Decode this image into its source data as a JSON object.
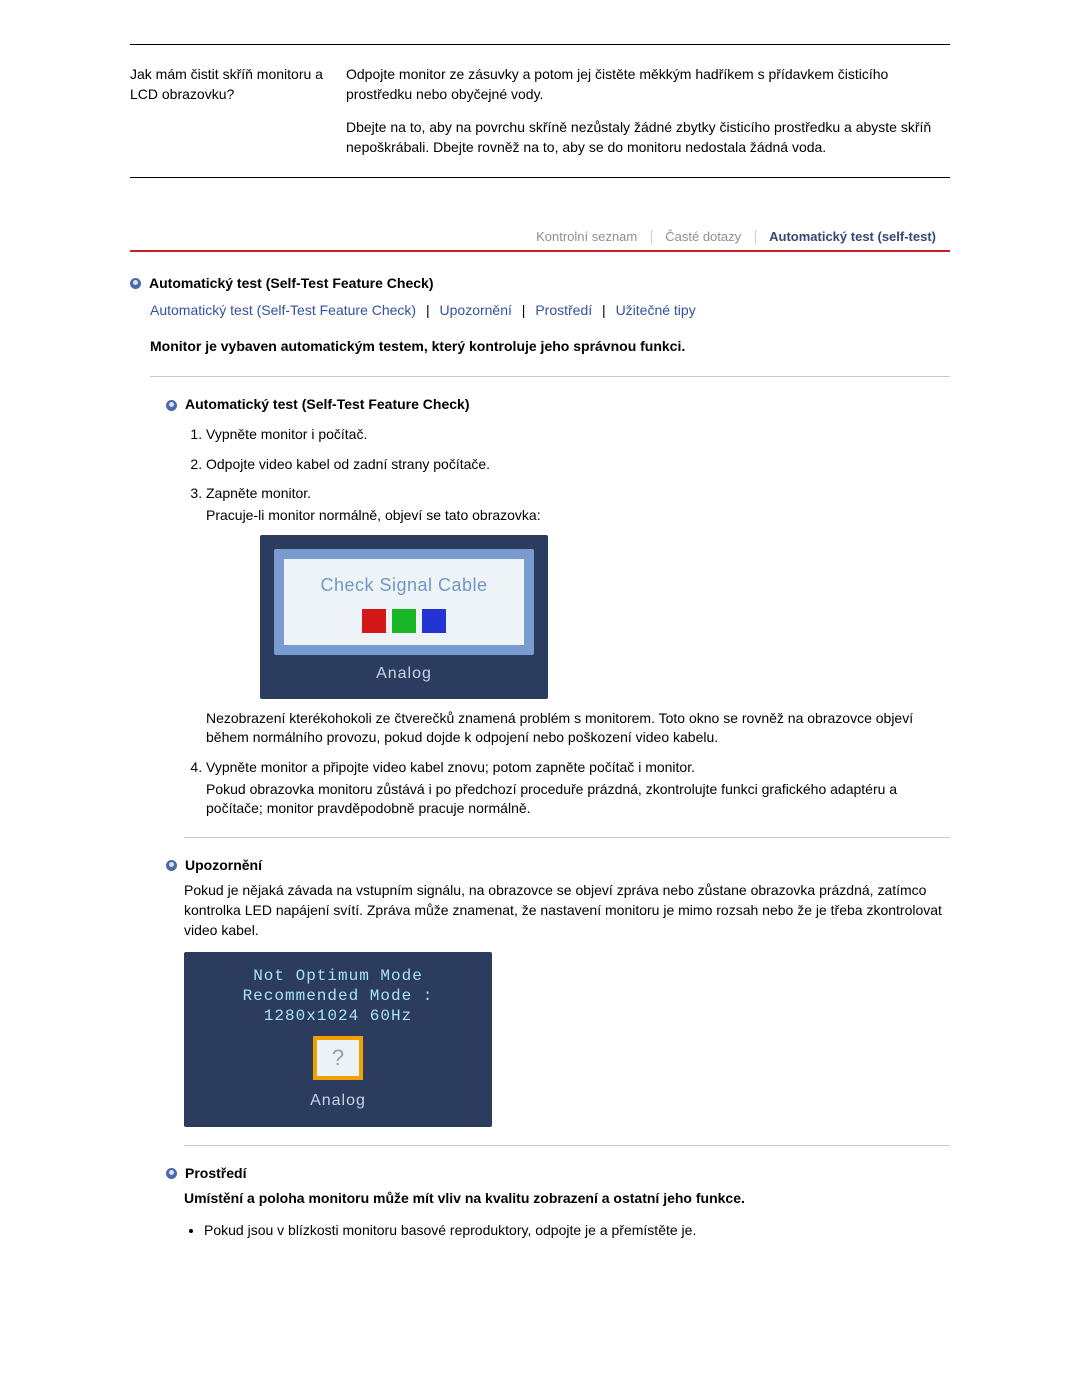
{
  "faq": {
    "question": "Jak mám čistit skříň monitoru a LCD obrazovku?",
    "answer1": "Odpojte monitor ze zásuvky a potom jej čistěte měkkým hadříkem s přídavkem čisticího prostředku nebo obyčejné vody.",
    "answer2": "Dbejte na to, aby na povrchu skříně nezůstaly žádné zbytky čisticího prostředku a abyste skříň nepoškrábali. Dbejte rovněž na to, aby se do monitoru nedostala žádná voda."
  },
  "tabs": {
    "t1": "Kontrolní seznam",
    "t2": "Časté dotazy",
    "t3": "Automatický test (self-test)"
  },
  "heading_main": "Automatický test (Self-Test Feature Check)",
  "links": {
    "a": "Automatický test (Self-Test Feature Check)",
    "b": "Upozornění",
    "c": "Prostředí",
    "d": "Užitečné tipy"
  },
  "intro": "Monitor je vybaven automatickým testem, který kontroluje jeho správnou funkci.",
  "sec_autotest": {
    "title": "Automatický test (Self-Test Feature Check)",
    "step1": "Vypněte monitor i počítač.",
    "step2": "Odpojte video kabel od zadní strany počítače.",
    "step3a": "Zapněte monitor.",
    "step3b": "Pracuje-li monitor normálně, objeví se tato obrazovka:",
    "osd_text": "Check Signal Cable",
    "osd_mode": "Analog",
    "step3_note": "Nezobrazení kterékohokoli ze čtverečků znamená problém s monitorem. Toto okno se rovněž na obrazovce objeví během normálního provozu, pokud dojde k odpojení nebo poškození video kabelu.",
    "step4a": "Vypněte monitor a připojte video kabel znovu; potom zapněte počítač i monitor.",
    "step4b": "Pokud obrazovka monitoru zůstává i po předchozí proceduře prázdná, zkontrolujte funkci grafického adaptéru a počítače; monitor pravděpodobně pracuje normálně."
  },
  "sec_warn": {
    "title": "Upozornění",
    "body": "Pokud je nějaká závada na vstupním signálu, na obrazovce se objeví zpráva nebo zůstane obrazovka prázdná, zatímco kontrolka LED napájení svítí. Zpráva může znamenat, že nastavení monitoru je mimo rozsah nebo že je třeba zkontrolovat video kabel.",
    "osd_line1": "Not Optimum Mode",
    "osd_line2": "Recommended Mode :",
    "osd_line3": "1280x1024 60Hz",
    "osd_q": "?",
    "osd_mode": "Analog"
  },
  "sec_env": {
    "title": "Prostředí",
    "body": "Umístění a poloha monitoru může mít vliv na kvalitu zobrazení a ostatní jeho funkce.",
    "bullet1": "Pokud jsou v blízkosti monitoru basové reproduktory, odpojte je a přemístěte je."
  }
}
